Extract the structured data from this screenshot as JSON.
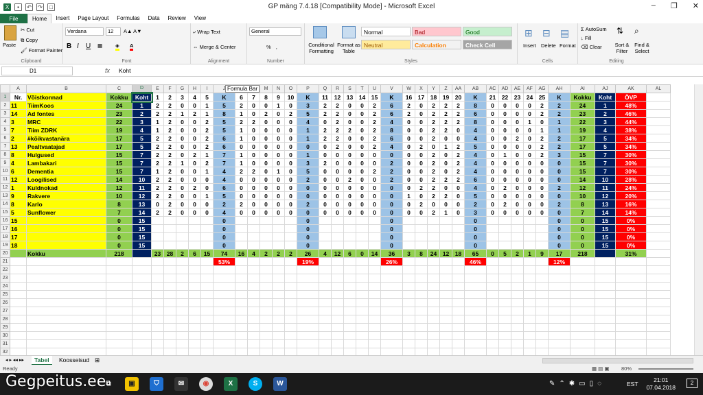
{
  "window": {
    "title": "GP mäng 7.4.18  [Compatibility Mode]  -  Microsoft Excel",
    "min": "–",
    "max": "❐",
    "close": "✕"
  },
  "tabs": [
    "File",
    "Home",
    "Insert",
    "Page Layout",
    "Formulas",
    "Data",
    "Review",
    "View"
  ],
  "ribbon": {
    "clipboard": {
      "label": "Clipboard",
      "paste": "Paste",
      "cut": "Cut",
      "copy": "Copy",
      "painter": "Format Painter"
    },
    "font": {
      "label": "Font",
      "name": "Verdana",
      "size": "12",
      "bold": "B",
      "italic": "I",
      "underline": "U"
    },
    "alignment": {
      "label": "Alignment",
      "wrap": "Wrap Text",
      "merge": "Merge & Center"
    },
    "number": {
      "label": "Number",
      "format": "General",
      "pct": "%",
      "comma": "‚"
    },
    "styles": {
      "label": "Styles",
      "cond": "Conditional Formatting",
      "table": "Format as Table",
      "normal": "Normal",
      "bad": "Bad",
      "good": "Good",
      "neutral": "Neutral",
      "calculation": "Calculation",
      "checkcell": "Check Cell"
    },
    "cells": {
      "label": "Cells",
      "insert": "Insert",
      "delete": "Delete",
      "format": "Format"
    },
    "editing": {
      "label": "Editing",
      "autosum": "AutoSum",
      "fill": "Fill",
      "clear": "Clear",
      "sort": "Sort & Filter",
      "find": "Find & Select"
    }
  },
  "formula": {
    "namebox": "D1",
    "fx": "fx",
    "value": "Koht",
    "tooltip": "Formula Bar"
  },
  "columns": [
    "A",
    "B",
    "C",
    "D",
    "E",
    "F",
    "G",
    "H",
    "I",
    "J",
    "K",
    "L",
    "M",
    "N",
    "O",
    "P",
    "Q",
    "R",
    "S",
    "T",
    "U",
    "V",
    "W",
    "X",
    "Y",
    "Z",
    "AA",
    "AB",
    "AC",
    "AD",
    "AE",
    "AF",
    "AG",
    "AH",
    "AI",
    "AJ",
    "AK",
    "AL"
  ],
  "header": [
    "Nr.",
    "Võistkonnad",
    "Kokku",
    "Koht",
    "1",
    "2",
    "3",
    "4",
    "5",
    "K",
    "6",
    "7",
    "8",
    "9",
    "10",
    "K",
    "11",
    "12",
    "13",
    "14",
    "15",
    "K",
    "16",
    "17",
    "18",
    "19",
    "20",
    "K",
    "21",
    "22",
    "23",
    "24",
    "25",
    "K",
    "Kokku",
    "Koht",
    "ÕVP",
    ""
  ],
  "rows": [
    [
      "11",
      "TiimKoos",
      "24",
      "1",
      "2",
      "2",
      "0",
      "0",
      "1",
      "5",
      "2",
      "0",
      "0",
      "1",
      "0",
      "3",
      "2",
      "2",
      "0",
      "0",
      "2",
      "6",
      "2",
      "0",
      "2",
      "2",
      "2",
      "8",
      "0",
      "0",
      "0",
      "0",
      "2",
      "2",
      "24",
      "1",
      "48%"
    ],
    [
      "14",
      "Ad fontes",
      "23",
      "2",
      "2",
      "2",
      "1",
      "2",
      "1",
      "8",
      "1",
      "0",
      "2",
      "0",
      "2",
      "5",
      "2",
      "2",
      "0",
      "0",
      "2",
      "6",
      "2",
      "0",
      "2",
      "2",
      "2",
      "6",
      "0",
      "0",
      "0",
      "0",
      "2",
      "2",
      "23",
      "2",
      "46%"
    ],
    [
      "3",
      "MRC",
      "22",
      "3",
      "1",
      "2",
      "0",
      "0",
      "2",
      "5",
      "2",
      "2",
      "0",
      "0",
      "0",
      "4",
      "0",
      "2",
      "0",
      "0",
      "2",
      "4",
      "0",
      "0",
      "2",
      "2",
      "2",
      "8",
      "0",
      "0",
      "0",
      "1",
      "0",
      "1",
      "22",
      "3",
      "44%"
    ],
    [
      "7",
      "Tiim ZDRK",
      "19",
      "4",
      "1",
      "2",
      "0",
      "0",
      "2",
      "5",
      "1",
      "0",
      "0",
      "0",
      "0",
      "1",
      "2",
      "2",
      "2",
      "0",
      "2",
      "8",
      "0",
      "0",
      "2",
      "2",
      "0",
      "4",
      "0",
      "0",
      "0",
      "0",
      "1",
      "1",
      "19",
      "4",
      "38%"
    ],
    [
      "2",
      "#kõikvastanära",
      "17",
      "5",
      "2",
      "2",
      "0",
      "0",
      "2",
      "6",
      "1",
      "0",
      "0",
      "0",
      "0",
      "1",
      "2",
      "2",
      "0",
      "0",
      "2",
      "6",
      "0",
      "0",
      "2",
      "0",
      "0",
      "4",
      "0",
      "0",
      "2",
      "0",
      "2",
      "2",
      "17",
      "5",
      "34%"
    ],
    [
      "13",
      "Pealtvaatajad",
      "17",
      "5",
      "2",
      "2",
      "0",
      "0",
      "2",
      "6",
      "0",
      "0",
      "0",
      "0",
      "0",
      "0",
      "0",
      "2",
      "0",
      "0",
      "2",
      "4",
      "0",
      "2",
      "0",
      "1",
      "2",
      "5",
      "0",
      "0",
      "0",
      "0",
      "2",
      "2",
      "17",
      "5",
      "34%"
    ],
    [
      "8",
      "Hulgused",
      "15",
      "7",
      "2",
      "2",
      "0",
      "2",
      "1",
      "7",
      "1",
      "0",
      "0",
      "0",
      "0",
      "1",
      "0",
      "0",
      "0",
      "0",
      "0",
      "0",
      "0",
      "0",
      "2",
      "0",
      "2",
      "4",
      "0",
      "1",
      "0",
      "0",
      "2",
      "3",
      "15",
      "7",
      "30%"
    ],
    [
      "4",
      "Lambakari",
      "15",
      "7",
      "2",
      "2",
      "1",
      "0",
      "2",
      "7",
      "1",
      "0",
      "0",
      "0",
      "0",
      "3",
      "2",
      "0",
      "0",
      "0",
      "0",
      "2",
      "0",
      "0",
      "2",
      "0",
      "2",
      "4",
      "0",
      "0",
      "0",
      "0",
      "0",
      "0",
      "15",
      "7",
      "30%"
    ],
    [
      "6",
      "Dementia",
      "15",
      "7",
      "1",
      "2",
      "0",
      "0",
      "1",
      "4",
      "2",
      "2",
      "0",
      "1",
      "0",
      "5",
      "0",
      "0",
      "0",
      "0",
      "2",
      "2",
      "0",
      "0",
      "2",
      "0",
      "2",
      "4",
      "0",
      "0",
      "0",
      "0",
      "0",
      "0",
      "15",
      "7",
      "30%"
    ],
    [
      "12",
      "Loogilised",
      "14",
      "10",
      "2",
      "2",
      "0",
      "0",
      "0",
      "4",
      "0",
      "0",
      "0",
      "0",
      "0",
      "2",
      "0",
      "0",
      "2",
      "0",
      "0",
      "2",
      "0",
      "0",
      "2",
      "2",
      "2",
      "6",
      "0",
      "0",
      "0",
      "0",
      "0",
      "0",
      "14",
      "10",
      "28%"
    ],
    [
      "1",
      "Kuldnokad",
      "12",
      "11",
      "2",
      "2",
      "0",
      "2",
      "0",
      "6",
      "0",
      "0",
      "0",
      "0",
      "0",
      "0",
      "0",
      "0",
      "0",
      "0",
      "0",
      "0",
      "0",
      "2",
      "2",
      "0",
      "0",
      "4",
      "0",
      "2",
      "0",
      "0",
      "0",
      "2",
      "12",
      "11",
      "24%"
    ],
    [
      "9",
      "Rakvere",
      "10",
      "12",
      "2",
      "2",
      "0",
      "0",
      "1",
      "5",
      "0",
      "0",
      "0",
      "0",
      "0",
      "0",
      "0",
      "0",
      "0",
      "0",
      "0",
      "0",
      "1",
      "0",
      "2",
      "2",
      "0",
      "5",
      "0",
      "0",
      "0",
      "0",
      "0",
      "0",
      "10",
      "12",
      "20%"
    ],
    [
      "8",
      "Karlo",
      "8",
      "13",
      "0",
      "2",
      "0",
      "0",
      "0",
      "2",
      "2",
      "0",
      "0",
      "0",
      "0",
      "2",
      "0",
      "0",
      "0",
      "0",
      "0",
      "0",
      "0",
      "2",
      "0",
      "0",
      "0",
      "2",
      "0",
      "2",
      "0",
      "0",
      "0",
      "2",
      "8",
      "13",
      "16%"
    ],
    [
      "5",
      "Sunflower",
      "7",
      "14",
      "2",
      "2",
      "0",
      "0",
      "0",
      "4",
      "0",
      "0",
      "0",
      "0",
      "0",
      "0",
      "0",
      "0",
      "0",
      "0",
      "0",
      "0",
      "0",
      "0",
      "2",
      "1",
      "0",
      "3",
      "0",
      "0",
      "0",
      "0",
      "0",
      "0",
      "7",
      "14",
      "14%"
    ],
    [
      "15",
      "",
      "0",
      "15",
      "",
      "",
      "",
      "",
      "",
      "0",
      "",
      "",
      "",
      "",
      "",
      "0",
      "",
      "",
      "",
      "",
      "",
      "0",
      "",
      "",
      "",
      "",
      "",
      "0",
      "",
      "",
      "",
      "",
      "",
      "0",
      "0",
      "15",
      "0%"
    ],
    [
      "16",
      "",
      "0",
      "15",
      "",
      "",
      "",
      "",
      "",
      "0",
      "",
      "",
      "",
      "",
      "",
      "0",
      "",
      "",
      "",
      "",
      "",
      "0",
      "",
      "",
      "",
      "",
      "",
      "0",
      "",
      "",
      "",
      "",
      "",
      "0",
      "0",
      "15",
      "0%"
    ],
    [
      "17",
      "",
      "0",
      "15",
      "",
      "",
      "",
      "",
      "",
      "0",
      "",
      "",
      "",
      "",
      "",
      "0",
      "",
      "",
      "",
      "",
      "",
      "0",
      "",
      "",
      "",
      "",
      "",
      "0",
      "",
      "",
      "",
      "",
      "",
      "0",
      "0",
      "15",
      "0%"
    ],
    [
      "18",
      "",
      "0",
      "15",
      "",
      "",
      "",
      "",
      "",
      "0",
      "",
      "",
      "",
      "",
      "",
      "0",
      "",
      "",
      "",
      "",
      "",
      "0",
      "",
      "",
      "",
      "",
      "",
      "0",
      "",
      "",
      "",
      "",
      "",
      "0",
      "0",
      "15",
      "0%"
    ]
  ],
  "totals": [
    "",
    "Kokku",
    "218",
    "",
    "23",
    "28",
    "2",
    "6",
    "15",
    "74",
    "16",
    "4",
    "2",
    "2",
    "2",
    "26",
    "4",
    "12",
    "6",
    "0",
    "14",
    "36",
    "3",
    "8",
    "24",
    "12",
    "18",
    "65",
    "0",
    "5",
    "2",
    "1",
    "9",
    "17",
    "218",
    "",
    "31%"
  ],
  "percents": {
    "J": "53%",
    "P": "19%",
    "V": "26%",
    "AB": "46%",
    "AH": "12%"
  },
  "sheets": [
    "Tabel",
    "Koosseisud"
  ],
  "status": {
    "ready": "Ready",
    "zoom": "80%"
  },
  "taskbar": {
    "time": "21:01",
    "date": "07.04.2018",
    "lang": "EST",
    "notif": "2"
  },
  "watermark": "Gegpeitus.ee"
}
